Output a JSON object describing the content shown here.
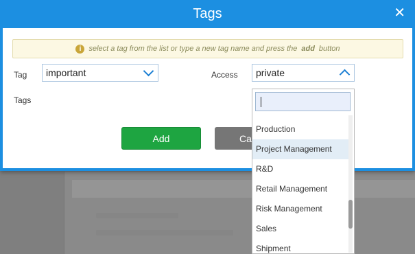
{
  "dialog": {
    "title": "Tags",
    "close_glyph": "✕"
  },
  "info": {
    "icon": "info-icon",
    "icon_glyph": "i",
    "text_before": "select a tag from the list or type a new tag name and press the",
    "text_bold": "add",
    "text_after": "button"
  },
  "form": {
    "tag_label": "Tag",
    "tag_value": "important",
    "access_label": "Access",
    "access_value": "private",
    "tags_label": "Tags"
  },
  "buttons": {
    "add_label": "Add",
    "cancel_label": "Ca"
  },
  "dropdown": {
    "search_value": "",
    "items": [
      {
        "label": "Production",
        "highlighted": false
      },
      {
        "label": "Project Management",
        "highlighted": true
      },
      {
        "label": "R&D",
        "highlighted": false
      },
      {
        "label": "Retail Management",
        "highlighted": false
      },
      {
        "label": "Risk Management",
        "highlighted": false
      },
      {
        "label": "Sales",
        "highlighted": false
      },
      {
        "label": "Shipment",
        "highlighted": false
      }
    ]
  },
  "colors": {
    "titlebar": "#1c8fe1",
    "add_button": "#1ea541",
    "cancel_button": "#767676",
    "info_background": "#fcf8e3",
    "highlight": "#e2edf6"
  }
}
